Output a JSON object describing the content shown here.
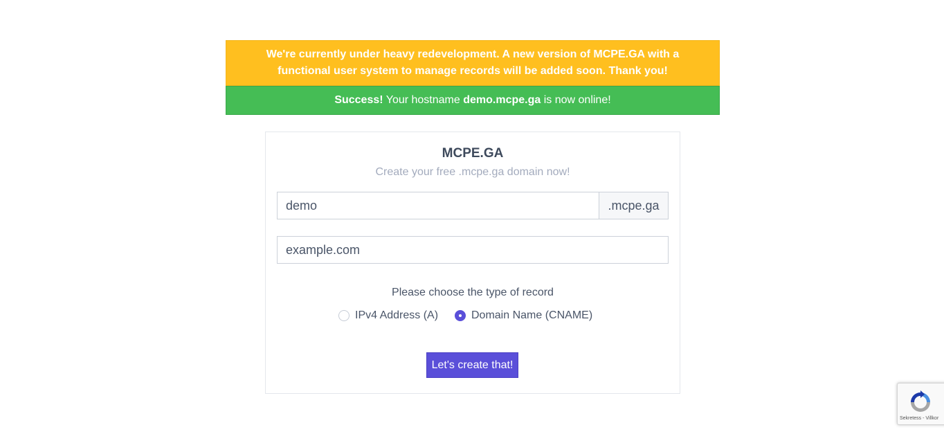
{
  "notice": {
    "warning_text": "We're currently under heavy redevelopment. A new version of MCPE.GA with a functional user system to manage records will be added soon. Thank you!",
    "success_prefix": "Success!",
    "success_text_before": "Your hostname",
    "success_hostname": "demo.mcpe.ga",
    "success_text_after": "is now online!"
  },
  "form": {
    "title": "MCPE.GA",
    "subtitle": "Create your free .mcpe.ga domain now!",
    "hostname_value": "demo",
    "domain_suffix": ".mcpe.ga",
    "target_value": "example.com",
    "record_type_label": "Please choose the type of record",
    "record_types": [
      {
        "label": "IPv4 Address (A)",
        "checked": false
      },
      {
        "label": "Domain Name (CNAME)",
        "checked": true
      }
    ],
    "submit_label": "Let's create that!"
  },
  "recaptcha": {
    "footer_text": "Sekretess - Villkor"
  },
  "colors": {
    "warning": "#ffbf1f",
    "success": "#45bd55",
    "primary": "#5a4fd9"
  }
}
